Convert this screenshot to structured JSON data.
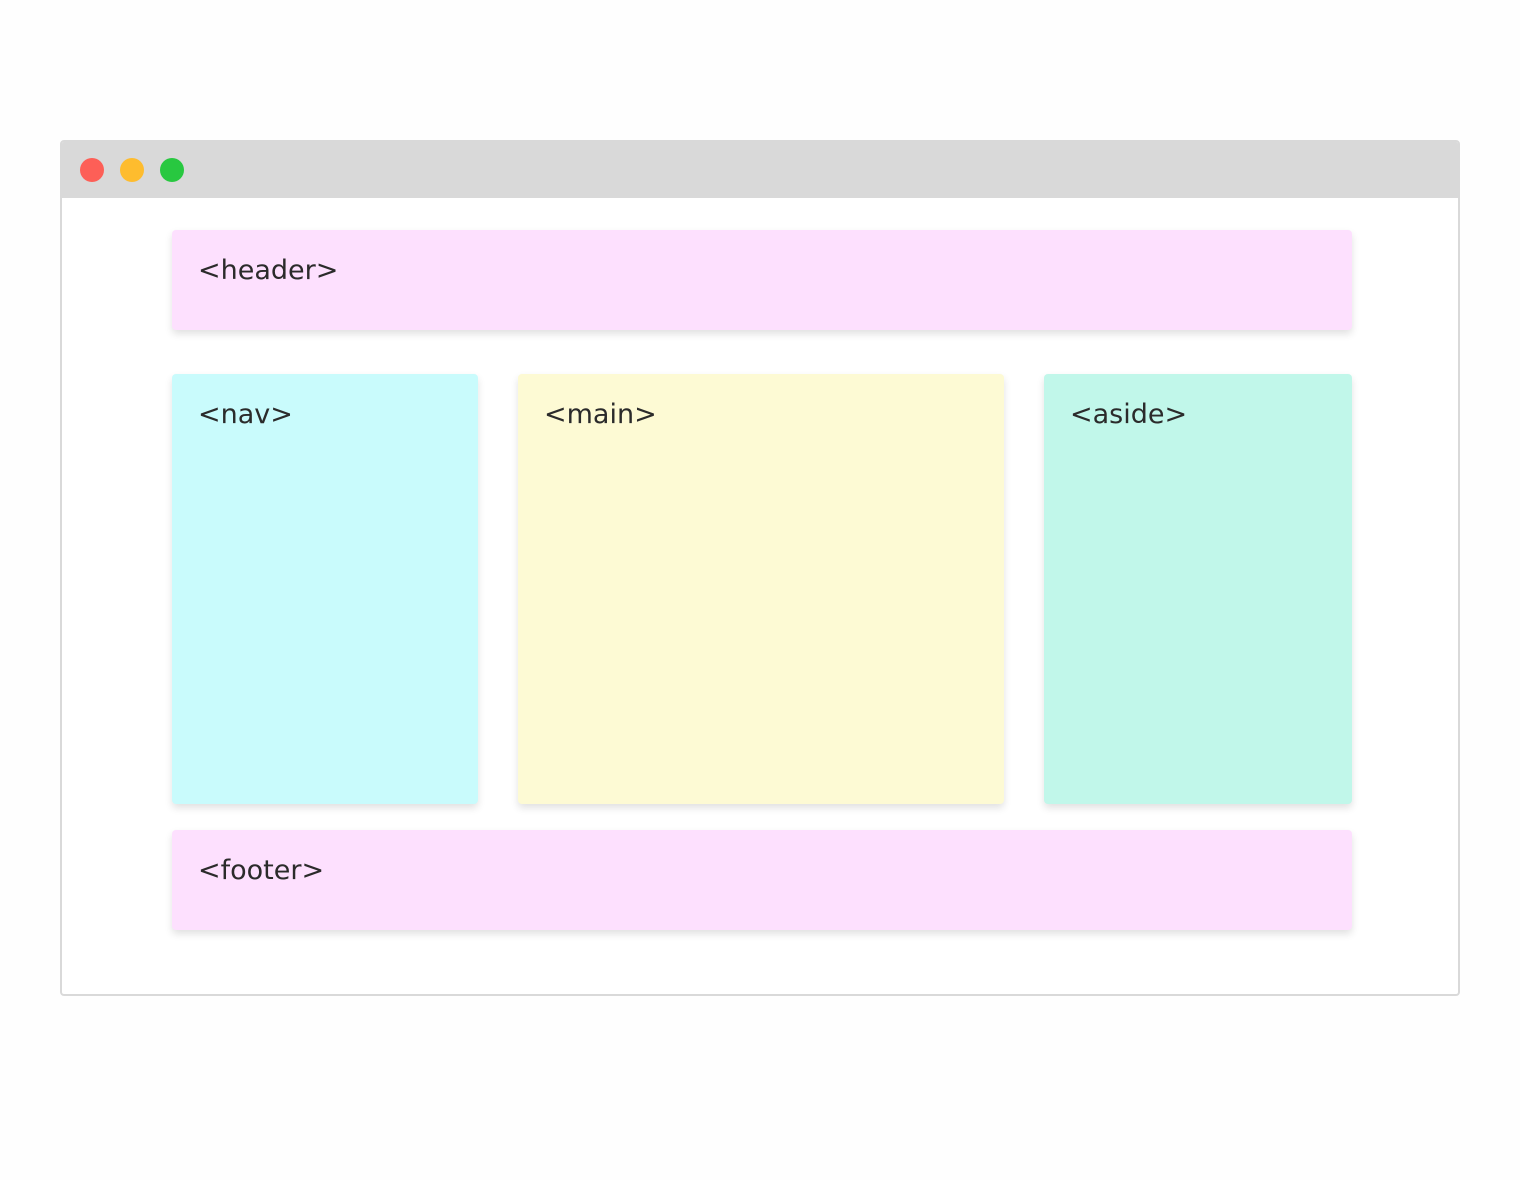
{
  "colors": {
    "titlebar": "#d9d9d9",
    "close_dot": "#fd5f57",
    "minimize_dot": "#febc2e",
    "maximize_dot": "#28c840",
    "header_bg": "#fde0fe",
    "nav_bg": "#c9fbfc",
    "main_bg": "#fdfad4",
    "aside_bg": "#c1f7ea",
    "footer_bg": "#fde0fe"
  },
  "blocks": {
    "header": "<header>",
    "nav": "<nav>",
    "main": "<main>",
    "aside": "<aside>",
    "footer": "<footer>"
  }
}
